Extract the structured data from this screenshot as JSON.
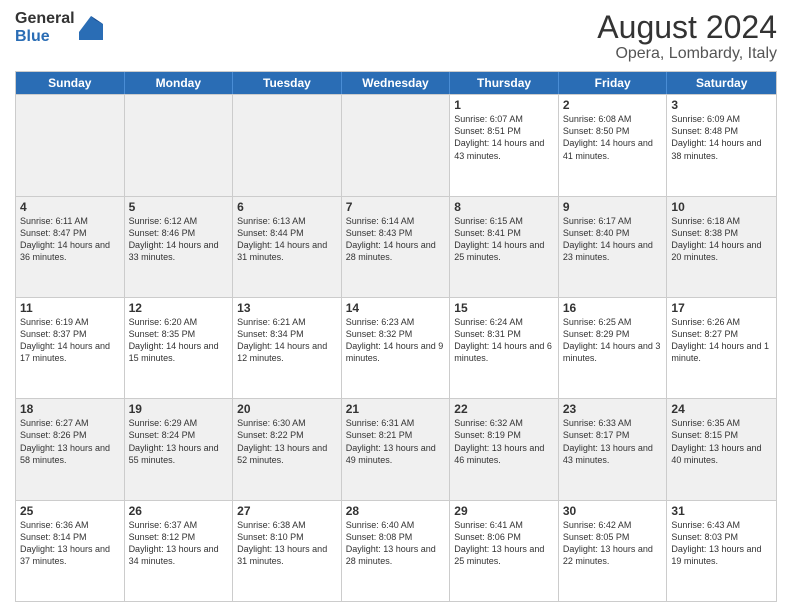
{
  "logo": {
    "general": "General",
    "blue": "Blue"
  },
  "title": "August 2024",
  "subtitle": "Opera, Lombardy, Italy",
  "header_days": [
    "Sunday",
    "Monday",
    "Tuesday",
    "Wednesday",
    "Thursday",
    "Friday",
    "Saturday"
  ],
  "rows": [
    [
      {
        "day": "",
        "text": "",
        "shaded": true
      },
      {
        "day": "",
        "text": "",
        "shaded": true
      },
      {
        "day": "",
        "text": "",
        "shaded": true
      },
      {
        "day": "",
        "text": "",
        "shaded": true
      },
      {
        "day": "1",
        "text": "Sunrise: 6:07 AM\nSunset: 8:51 PM\nDaylight: 14 hours and 43 minutes.",
        "shaded": false
      },
      {
        "day": "2",
        "text": "Sunrise: 6:08 AM\nSunset: 8:50 PM\nDaylight: 14 hours and 41 minutes.",
        "shaded": false
      },
      {
        "day": "3",
        "text": "Sunrise: 6:09 AM\nSunset: 8:48 PM\nDaylight: 14 hours and 38 minutes.",
        "shaded": false
      }
    ],
    [
      {
        "day": "4",
        "text": "Sunrise: 6:11 AM\nSunset: 8:47 PM\nDaylight: 14 hours and 36 minutes.",
        "shaded": true
      },
      {
        "day": "5",
        "text": "Sunrise: 6:12 AM\nSunset: 8:46 PM\nDaylight: 14 hours and 33 minutes.",
        "shaded": true
      },
      {
        "day": "6",
        "text": "Sunrise: 6:13 AM\nSunset: 8:44 PM\nDaylight: 14 hours and 31 minutes.",
        "shaded": true
      },
      {
        "day": "7",
        "text": "Sunrise: 6:14 AM\nSunset: 8:43 PM\nDaylight: 14 hours and 28 minutes.",
        "shaded": true
      },
      {
        "day": "8",
        "text": "Sunrise: 6:15 AM\nSunset: 8:41 PM\nDaylight: 14 hours and 25 minutes.",
        "shaded": true
      },
      {
        "day": "9",
        "text": "Sunrise: 6:17 AM\nSunset: 8:40 PM\nDaylight: 14 hours and 23 minutes.",
        "shaded": true
      },
      {
        "day": "10",
        "text": "Sunrise: 6:18 AM\nSunset: 8:38 PM\nDaylight: 14 hours and 20 minutes.",
        "shaded": true
      }
    ],
    [
      {
        "day": "11",
        "text": "Sunrise: 6:19 AM\nSunset: 8:37 PM\nDaylight: 14 hours and 17 minutes.",
        "shaded": false
      },
      {
        "day": "12",
        "text": "Sunrise: 6:20 AM\nSunset: 8:35 PM\nDaylight: 14 hours and 15 minutes.",
        "shaded": false
      },
      {
        "day": "13",
        "text": "Sunrise: 6:21 AM\nSunset: 8:34 PM\nDaylight: 14 hours and 12 minutes.",
        "shaded": false
      },
      {
        "day": "14",
        "text": "Sunrise: 6:23 AM\nSunset: 8:32 PM\nDaylight: 14 hours and 9 minutes.",
        "shaded": false
      },
      {
        "day": "15",
        "text": "Sunrise: 6:24 AM\nSunset: 8:31 PM\nDaylight: 14 hours and 6 minutes.",
        "shaded": false
      },
      {
        "day": "16",
        "text": "Sunrise: 6:25 AM\nSunset: 8:29 PM\nDaylight: 14 hours and 3 minutes.",
        "shaded": false
      },
      {
        "day": "17",
        "text": "Sunrise: 6:26 AM\nSunset: 8:27 PM\nDaylight: 14 hours and 1 minute.",
        "shaded": false
      }
    ],
    [
      {
        "day": "18",
        "text": "Sunrise: 6:27 AM\nSunset: 8:26 PM\nDaylight: 13 hours and 58 minutes.",
        "shaded": true
      },
      {
        "day": "19",
        "text": "Sunrise: 6:29 AM\nSunset: 8:24 PM\nDaylight: 13 hours and 55 minutes.",
        "shaded": true
      },
      {
        "day": "20",
        "text": "Sunrise: 6:30 AM\nSunset: 8:22 PM\nDaylight: 13 hours and 52 minutes.",
        "shaded": true
      },
      {
        "day": "21",
        "text": "Sunrise: 6:31 AM\nSunset: 8:21 PM\nDaylight: 13 hours and 49 minutes.",
        "shaded": true
      },
      {
        "day": "22",
        "text": "Sunrise: 6:32 AM\nSunset: 8:19 PM\nDaylight: 13 hours and 46 minutes.",
        "shaded": true
      },
      {
        "day": "23",
        "text": "Sunrise: 6:33 AM\nSunset: 8:17 PM\nDaylight: 13 hours and 43 minutes.",
        "shaded": true
      },
      {
        "day": "24",
        "text": "Sunrise: 6:35 AM\nSunset: 8:15 PM\nDaylight: 13 hours and 40 minutes.",
        "shaded": true
      }
    ],
    [
      {
        "day": "25",
        "text": "Sunrise: 6:36 AM\nSunset: 8:14 PM\nDaylight: 13 hours and 37 minutes.",
        "shaded": false
      },
      {
        "day": "26",
        "text": "Sunrise: 6:37 AM\nSunset: 8:12 PM\nDaylight: 13 hours and 34 minutes.",
        "shaded": false
      },
      {
        "day": "27",
        "text": "Sunrise: 6:38 AM\nSunset: 8:10 PM\nDaylight: 13 hours and 31 minutes.",
        "shaded": false
      },
      {
        "day": "28",
        "text": "Sunrise: 6:40 AM\nSunset: 8:08 PM\nDaylight: 13 hours and 28 minutes.",
        "shaded": false
      },
      {
        "day": "29",
        "text": "Sunrise: 6:41 AM\nSunset: 8:06 PM\nDaylight: 13 hours and 25 minutes.",
        "shaded": false
      },
      {
        "day": "30",
        "text": "Sunrise: 6:42 AM\nSunset: 8:05 PM\nDaylight: 13 hours and 22 minutes.",
        "shaded": false
      },
      {
        "day": "31",
        "text": "Sunrise: 6:43 AM\nSunset: 8:03 PM\nDaylight: 13 hours and 19 minutes.",
        "shaded": false
      }
    ]
  ]
}
